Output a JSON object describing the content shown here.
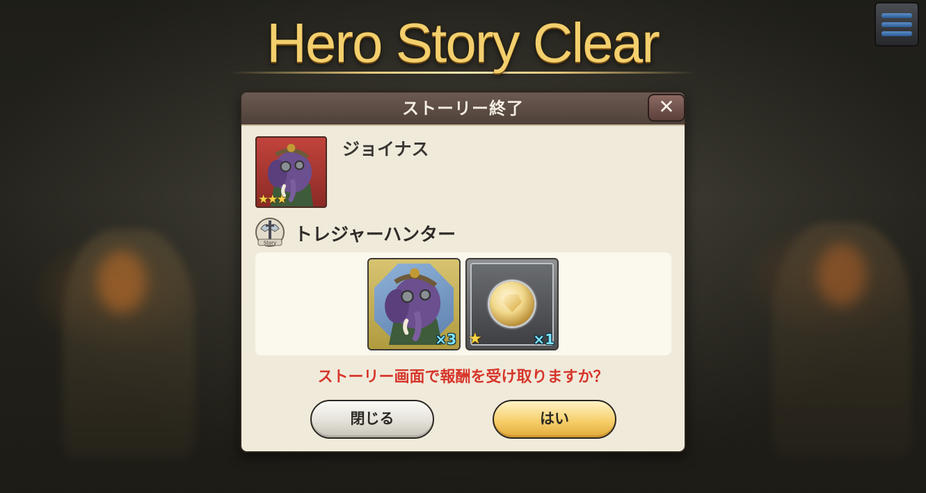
{
  "screen": {
    "banner_title": "Hero Story Clear"
  },
  "dialog": {
    "title": "ストーリー終了",
    "close_icon": "close-icon",
    "hero": {
      "name": "ジョイナス",
      "stars": "★★★",
      "rarity": 3
    },
    "story": {
      "icon": "story-icon",
      "title": "トレジャーハンター"
    },
    "rewards": [
      {
        "type": "hero-fragment",
        "quantity": "×3"
      },
      {
        "type": "gem",
        "rarity_star": "★",
        "quantity": "×1"
      }
    ],
    "prompt": "ストーリー画面で報酬を受け取りますか？",
    "buttons": {
      "close": "閉じる",
      "yes": "はい"
    }
  },
  "colors": {
    "title_gold": "#f3cf6d",
    "prompt_red": "#d6362b",
    "yes_button": "#f6cf6a"
  }
}
